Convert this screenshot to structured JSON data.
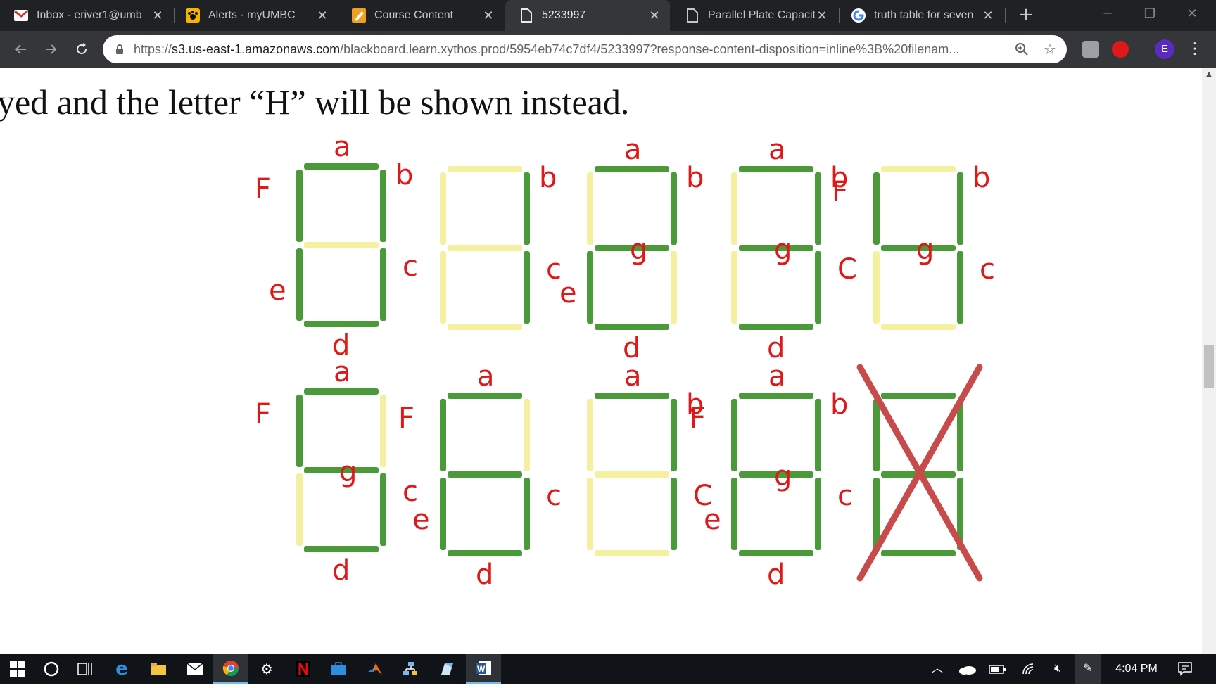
{
  "tabs": [
    {
      "title": "Inbox - eriver1@umb",
      "icon": "gmail-icon"
    },
    {
      "title": "Alerts · myUMBC",
      "icon": "umbc-paw-icon"
    },
    {
      "title": "Course Content",
      "icon": "blackboard-icon"
    },
    {
      "title": "5233997",
      "icon": "document-icon",
      "active": true
    },
    {
      "title": "Parallel Plate Capacit",
      "icon": "document-icon"
    },
    {
      "title": "truth table for seven",
      "icon": "google-icon"
    }
  ],
  "toolbar": {
    "url_prefix": "https://",
    "url_host": "s3.us-east-1.amazonaws.com",
    "url_path": "/blackboard.learn.xythos.prod/5954eb74c7df4/5233997?response-content-disposition=inline%3B%20filenam...",
    "avatar_letter": "E"
  },
  "document": {
    "text_line": "yed and the letter “H” will be shown instead."
  },
  "figure": {
    "colors": {
      "on": "#4a9a3a",
      "off": "#f4f0a0",
      "ink": "#e01818",
      "cross": "#c84a4a"
    },
    "digits": [
      {
        "segments_on": [
          "a",
          "b",
          "c",
          "d",
          "e",
          "f"
        ],
        "annotations": [
          "a",
          "b",
          "F",
          "e",
          "d",
          "c"
        ]
      },
      {
        "segments_on": [
          "b",
          "c"
        ],
        "annotations": [
          "b",
          "c"
        ]
      },
      {
        "segments_on": [
          "a",
          "b",
          "g",
          "e",
          "d"
        ],
        "annotations": [
          "a",
          "b",
          "g",
          "e",
          "d"
        ]
      },
      {
        "segments_on": [
          "a",
          "b",
          "g",
          "c",
          "d"
        ],
        "annotations": [
          "a",
          "b",
          "g",
          "C",
          "d"
        ]
      },
      {
        "segments_on": [
          "f",
          "b",
          "g",
          "c"
        ],
        "annotations": [
          "F",
          "b",
          "g",
          "c"
        ]
      },
      {
        "segments_on": [
          "a",
          "f",
          "g",
          "c",
          "d"
        ],
        "annotations": [
          "a",
          "F",
          "g",
          "c",
          "d"
        ]
      },
      {
        "segments_on": [
          "a",
          "f",
          "g",
          "e",
          "c",
          "d"
        ],
        "annotations": [
          "a",
          "F",
          "e",
          "c",
          "d"
        ]
      },
      {
        "segments_on": [
          "a",
          "b",
          "c"
        ],
        "annotations": [
          "a",
          "b",
          "C"
        ]
      },
      {
        "segments_on": [
          "a",
          "b",
          "c",
          "d",
          "e",
          "f",
          "g"
        ],
        "annotations": [
          "a",
          "F",
          "b",
          "g",
          "e",
          "c",
          "d"
        ]
      },
      {
        "segments_on": [
          "a",
          "b",
          "c",
          "d",
          "e",
          "f",
          "g"
        ],
        "annotations": [],
        "crossed_out": true
      }
    ]
  },
  "taskbar": {
    "time": "4:04 PM",
    "apps": [
      "windows-start-icon",
      "cortana-circle-icon",
      "task-view-icon",
      "edge-icon",
      "file-explorer-icon",
      "mail-icon",
      "chrome-icon",
      "settings-gear-icon",
      "netflix-icon",
      "store-icon",
      "matlab-icon",
      "network-app-icon",
      "paint-icon",
      "word-icon"
    ]
  }
}
